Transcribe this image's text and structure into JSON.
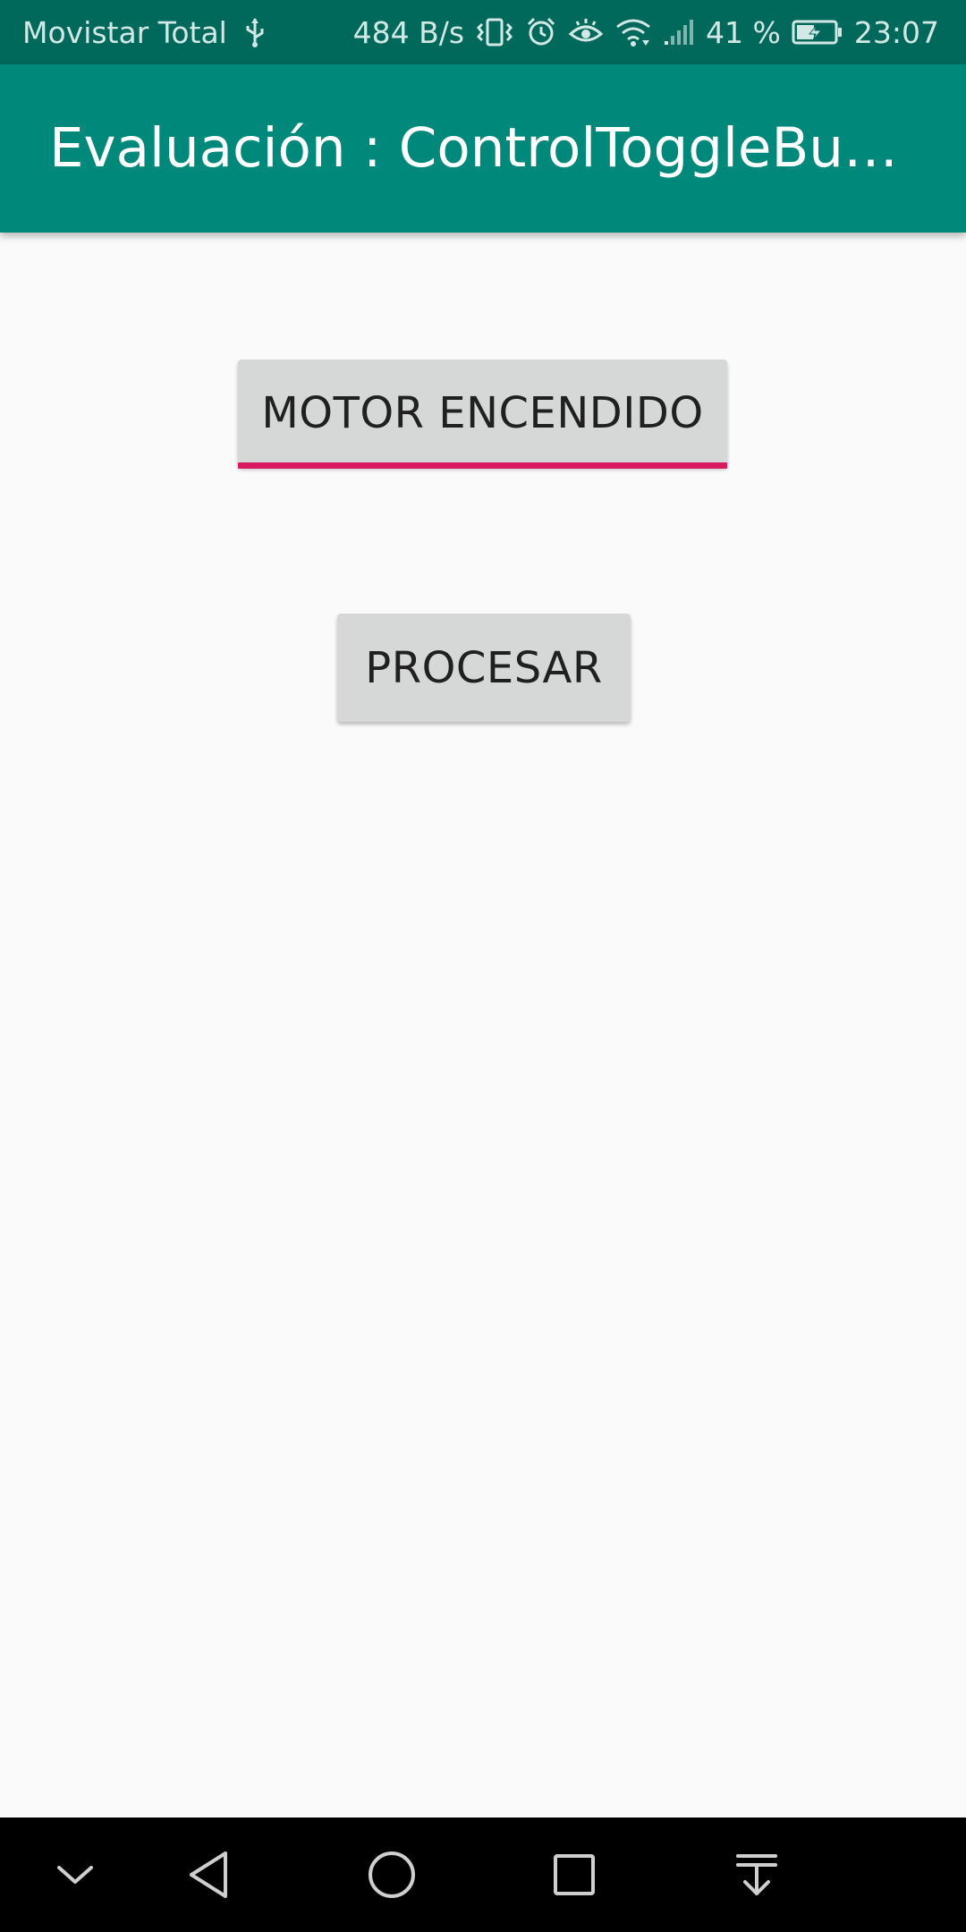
{
  "status_bar": {
    "carrier": "Movistar Total",
    "network_speed": "484 B/s",
    "battery_percent": "41 %",
    "time": "23:07",
    "icons": [
      "usb-icon",
      "vibrate-icon",
      "alarm-icon",
      "eye-comfort-icon",
      "wifi-icon",
      "signal-icon",
      "battery-charging-icon"
    ]
  },
  "app_bar": {
    "title": "Evaluación : ControlToggleBu…"
  },
  "main": {
    "toggle_button": {
      "label": "MOTOR ENCENDIDO",
      "checked": true
    },
    "process_button": {
      "label": "PROCESAR"
    }
  },
  "nav_bar": {
    "icons": [
      "hide-nav-icon",
      "back-icon",
      "home-icon",
      "recents-icon",
      "notifications-pull-icon"
    ]
  },
  "colors": {
    "status_bar": "#00695c",
    "app_bar": "#00897b",
    "accent": "#d81b60",
    "button": "#d6d7d7",
    "background": "#fafafa"
  }
}
